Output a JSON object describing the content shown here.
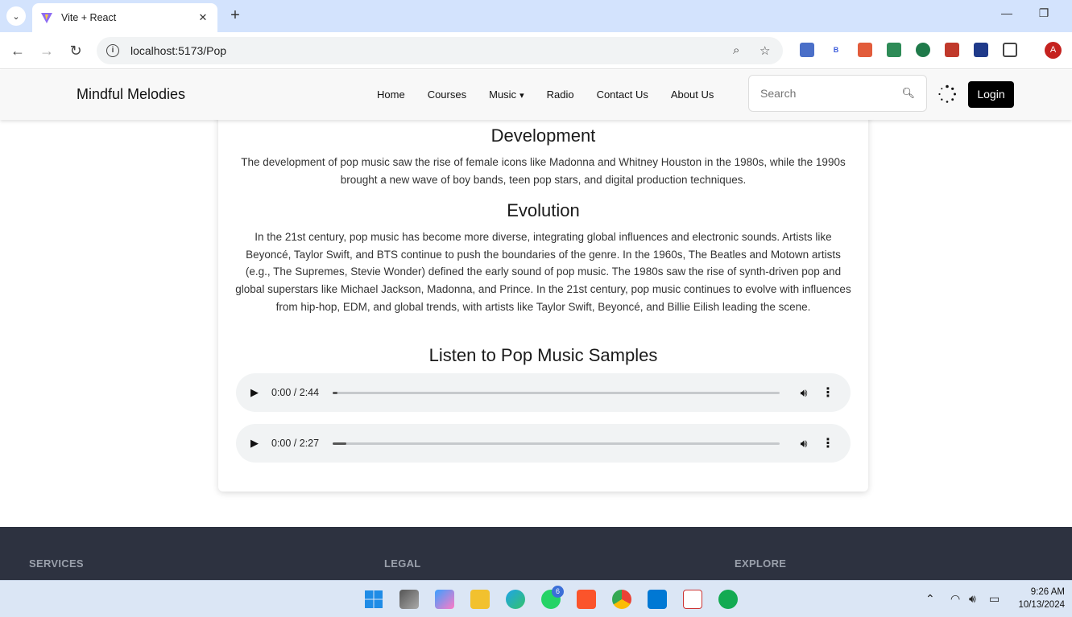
{
  "browser": {
    "tab_title": "Vite + React",
    "url": "localhost:5173/Pop",
    "profile_initial": "A"
  },
  "site": {
    "brand": "Mindful Melodies",
    "nav": [
      "Home",
      "Courses",
      "Music",
      "Radio",
      "Contact Us",
      "About Us"
    ],
    "search_placeholder": "Search",
    "login_label": "Login"
  },
  "content": {
    "sections": [
      {
        "heading": "Development",
        "text": "The development of pop music saw the rise of female icons like Madonna and Whitney Houston in the 1980s, while the 1990s brought a new wave of boy bands, teen pop stars, and digital production techniques."
      },
      {
        "heading": "Evolution",
        "text": "In the 21st century, pop music has become more diverse, integrating global influences and electronic sounds. Artists like Beyoncé, Taylor Swift, and BTS continue to push the boundaries of the genre. In the 1960s, The Beatles and Motown artists (e.g., The Supremes, Stevie Wonder) defined the early sound of pop music. The 1980s saw the rise of synth-driven pop and global superstars like Michael Jackson, Madonna, and Prince. In the 21st century, pop music continues to evolve with influences from hip-hop, EDM, and global trends, with artists like Taylor Swift, Beyoncé, and Billie Eilish leading the scene."
      }
    ],
    "samples_heading": "Listen to Pop Music Samples",
    "players": [
      {
        "time": "0:00 / 2:44",
        "buffered_fraction": 0.01
      },
      {
        "time": "0:00 / 2:27",
        "buffered_fraction": 0.03
      }
    ]
  },
  "footer": {
    "columns": [
      "SERVICES",
      "LEGAL",
      "EXPLORE"
    ]
  },
  "taskbar": {
    "whatsapp_badge": "6",
    "time": "9:26 AM",
    "date": "10/13/2024"
  }
}
